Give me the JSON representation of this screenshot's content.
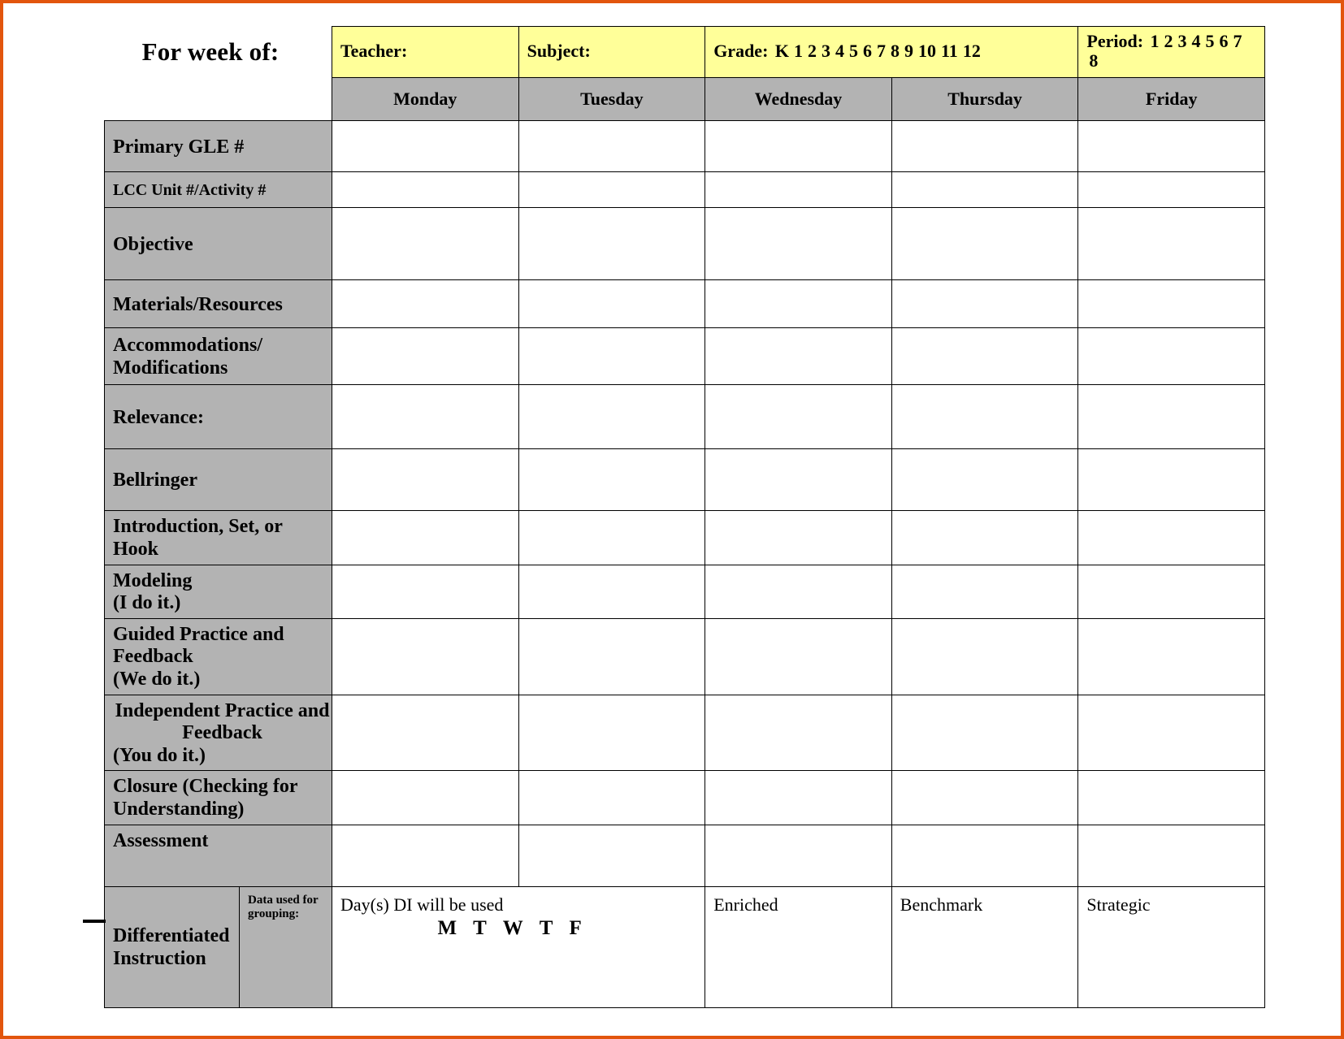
{
  "page": {
    "title_label": "For week of:",
    "accent_border_color": "#e2550d",
    "header_fill_color": "#ffff99",
    "label_fill_color": "#b3b3b3"
  },
  "header": {
    "teacher_label": "Teacher:",
    "subject_label": "Subject:",
    "grade_label": "Grade:",
    "grade_options": [
      "K",
      "1",
      "2",
      "3",
      "4",
      "5",
      "6",
      "7",
      "8",
      "9",
      "10",
      "11",
      "12"
    ],
    "period_label": "Period:",
    "period_options": [
      "1",
      "2",
      "3",
      "4",
      "5",
      "6",
      "7",
      "8"
    ]
  },
  "days": [
    "Monday",
    "Tuesday",
    "Wednesday",
    "Thursday",
    "Friday"
  ],
  "rows": [
    {
      "label": "Primary GLE #"
    },
    {
      "label": "LCC Unit #/Activity #"
    },
    {
      "label": "Objective"
    },
    {
      "label": "Materials/Resources"
    },
    {
      "label": "Accommodations/",
      "label2": "Modifications"
    },
    {
      "label": "Relevance:"
    },
    {
      "label": "Bellringer"
    },
    {
      "label": "Introduction, Set, or",
      "label2": "Hook"
    },
    {
      "label": "Modeling",
      "label2": "(I do it.)"
    },
    {
      "label": "Guided Practice and",
      "label2": "Feedback",
      "label3": "(We do it.)"
    },
    {
      "label": "Independent Practice and",
      "label2": "Feedback",
      "label3": "(You do it.)"
    },
    {
      "label": "Closure (Checking for",
      "label2": "Understanding)"
    },
    {
      "label": "Assessment"
    }
  ],
  "differentiated": {
    "title": "Differentiated",
    "title2": "Instruction",
    "grouping_label": "Data used for",
    "grouping_label2": "grouping:",
    "days_used_label": "Day(s) DI will be used",
    "day_initials": [
      "M",
      "T",
      "W",
      "T",
      "F"
    ],
    "tiers": [
      "Enriched",
      "Benchmark",
      "Strategic"
    ]
  }
}
